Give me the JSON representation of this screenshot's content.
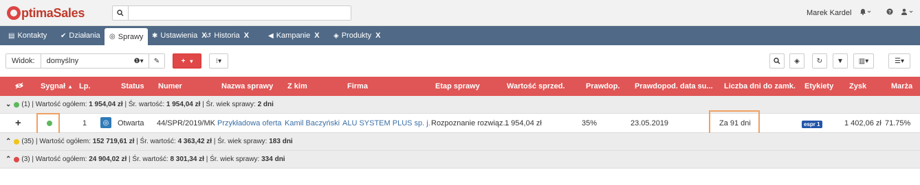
{
  "app": {
    "logo_text": "ptimaSales"
  },
  "header": {
    "search_placeholder": "",
    "user_name": "Marek Kardel"
  },
  "tabs": [
    {
      "label": "Kontakty",
      "closable": false,
      "active": false
    },
    {
      "label": "Działania",
      "closable": false,
      "active": false
    },
    {
      "label": "Sprawy",
      "closable": false,
      "active": true
    },
    {
      "label": "Ustawienia",
      "closable": true,
      "active": false
    },
    {
      "label": "Historia",
      "closable": true,
      "active": false
    },
    {
      "label": "Kampanie",
      "closable": true,
      "active": false
    },
    {
      "label": "Produkty",
      "closable": true,
      "active": false
    }
  ],
  "tab_close_label": "X",
  "toolbar": {
    "view_label": "Widok:",
    "view_value": "domyślny",
    "add_label": "+"
  },
  "columns": {
    "signal": "Sygnał",
    "sort_indicator": "▲",
    "lp": "Lp.",
    "status": "Status",
    "number": "Numer",
    "name": "Nazwa sprawy",
    "with": "Z kim",
    "company": "Firma",
    "stage": "Etap sprawy",
    "value": "Wartość sprzed.",
    "probability": "Prawdop.",
    "expected_date": "Prawdopod. data su...",
    "days_to_close": "Liczba dni do zamk.",
    "labels": "Etykiety",
    "profit": "Zysk",
    "margin": "Marża"
  },
  "groups": [
    {
      "color": "#5cb85c",
      "count": "(1)",
      "total_label": "| Wartość ogółem:",
      "total": "1 954,04 zł",
      "avg_label": "| Śr. wartość:",
      "avg": "1 954,04 zł",
      "age_label": "| Śr. wiek sprawy:",
      "age": "2 dni"
    },
    {
      "color": "#f0c419",
      "count": "(35)",
      "total_label": "| Wartość ogółem:",
      "total": "152 719,61 zł",
      "avg_label": "| Śr. wartość:",
      "avg": "4 363,42 zł",
      "age_label": "| Śr. wiek sprawy:",
      "age": "183 dni"
    },
    {
      "color": "#e04848",
      "count": "(3)",
      "total_label": "| Wartość ogółem:",
      "total": "24 904,02 zł",
      "avg_label": "| Śr. wartość:",
      "avg": "8 301,34 zł",
      "age_label": "| Śr. wiek sprawy:",
      "age": "334 dni"
    }
  ],
  "row": {
    "expand": "+",
    "lp": "1",
    "status": "Otwarta",
    "number": "44/SPR/2019/MK",
    "name": "Przykładowa oferta",
    "with": "Kamil Baczyński",
    "company": "ALU SYSTEM PLUS sp. j.",
    "stage": "Rozpoznanie rozwiąz...",
    "value": "1 954,04 zł",
    "probability": "35%",
    "expected_date": "23.05.2019",
    "days_to_close": "Za 91 dni",
    "label": "espr 1",
    "profit": "1 402,06 zł",
    "margin": "71.75%"
  },
  "colors": {
    "accent": "#e05555",
    "nav": "#4f6986",
    "highlight": "#f0a060",
    "signal_green": "#5cb85c"
  },
  "icons": [
    "search-icon",
    "bell-icon",
    "help-icon",
    "user-icon",
    "info-icon",
    "pencil-icon",
    "more-icon",
    "cube-icon",
    "refresh-icon",
    "filter-icon",
    "columns-icon",
    "list-icon",
    "eye-icon",
    "handshake-icon",
    "chevron-down-icon",
    "chevron-up-icon"
  ]
}
